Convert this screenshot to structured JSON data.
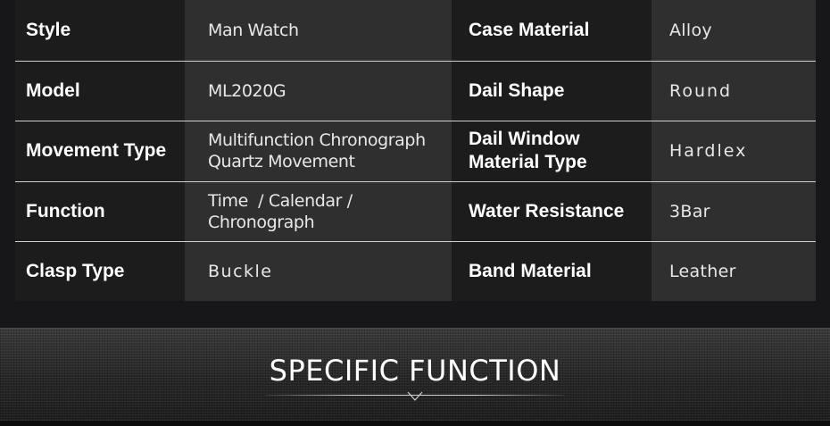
{
  "specs": [
    {
      "label": "Style",
      "value": "Man Watch",
      "label2": "Case Material",
      "value2": "Alloy"
    },
    {
      "label": "Model",
      "value": "ML2020G",
      "label2": "Dail Shape",
      "value2": "Round"
    },
    {
      "label": "Movement Type",
      "value": "Multifunction Chronograph\nQuartz Movement",
      "label2": "Dail Window\nMaterial Type",
      "value2": "Hardlex"
    },
    {
      "label": "Function",
      "value": "Time  / Calendar /\nChronograph",
      "label2": "Water Resistance",
      "value2": "3Bar"
    },
    {
      "label": "Clasp Type",
      "value": "Buckle",
      "label2": "Band Material",
      "value2": "Leather"
    }
  ],
  "banner": {
    "title": "SPECIFIC FUNCTION"
  },
  "colors": {
    "background": "#171719",
    "label_cell": "#1c1c1c",
    "value_cell": "#2f2f2f",
    "divider": "#cfcfcf",
    "text": "#ffffff"
  },
  "icons": {
    "banner_marker": "chevron-down-icon"
  }
}
